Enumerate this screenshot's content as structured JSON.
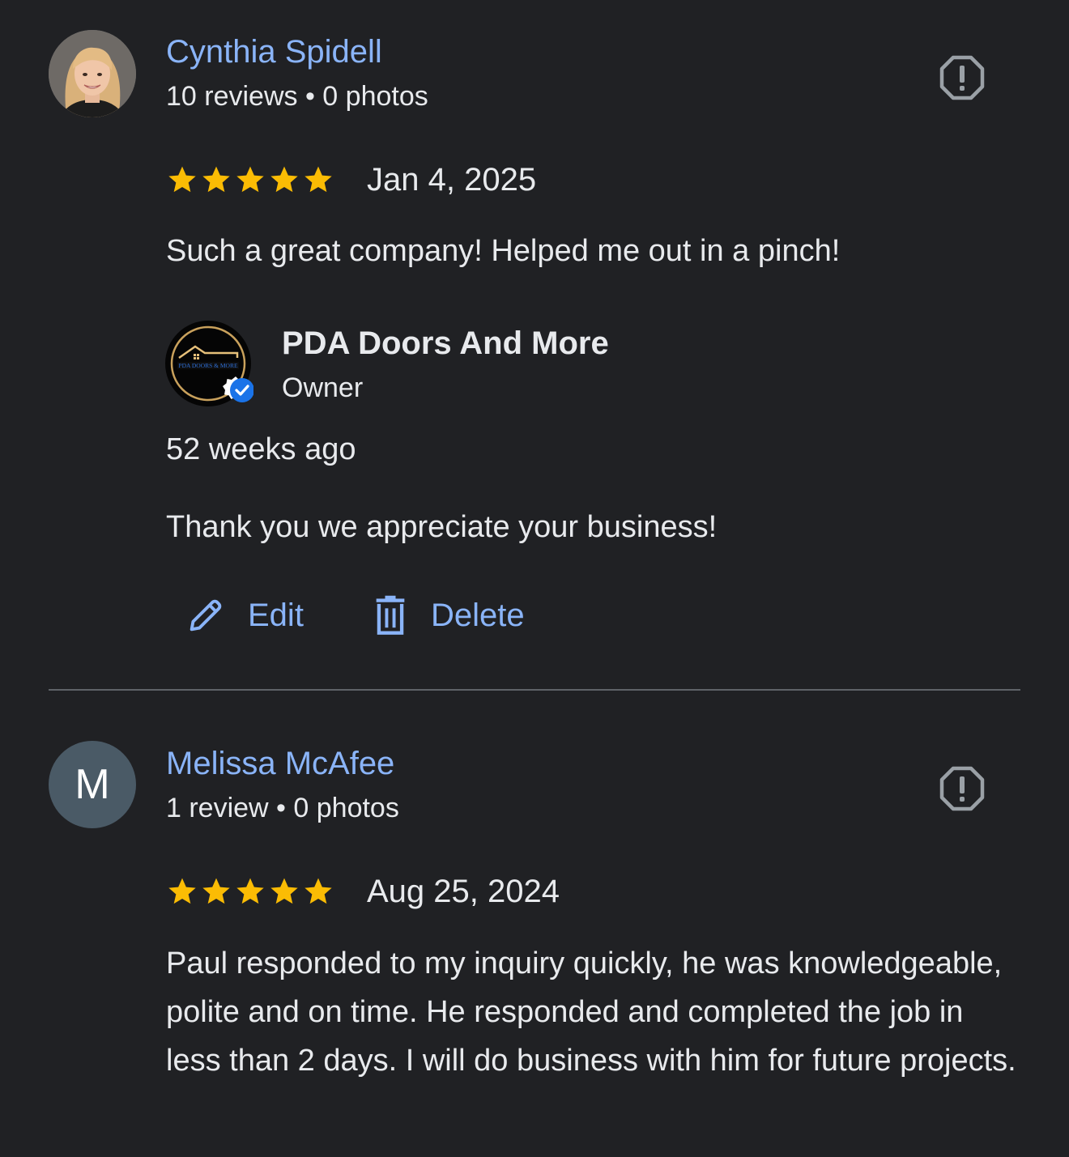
{
  "reviews": [
    {
      "reviewer_name": "Cynthia Spidell",
      "reviewer_meta": "10 reviews • 0 photos",
      "rating": 5,
      "date": "Jan 4, 2025",
      "text": "Such a great company! Helped me out in a pinch!",
      "owner_reply": {
        "name": "PDA Doors And More",
        "role": "Owner",
        "logo_text": "PDA DOORS & MORE",
        "time": "52 weeks ago",
        "text": "Thank you we appreciate your business!",
        "edit_label": "Edit",
        "delete_label": "Delete"
      }
    },
    {
      "reviewer_name": "Melissa McAfee",
      "avatar_letter": "M",
      "reviewer_meta": "1 review • 0 photos",
      "rating": 5,
      "date": "Aug 25, 2024",
      "text": "Paul responded to my inquiry quickly, he was knowledgeable, polite and on time. He responded and completed the job in less than 2 days. I will do business with him for future projects."
    }
  ],
  "colors": {
    "background": "#202124",
    "link": "#8ab4f8",
    "star": "#fbbc04",
    "text": "#e8eaed",
    "divider": "#5f6368",
    "verified": "#1a73e8"
  },
  "icons": {
    "report": "report-flag-icon",
    "edit": "pencil-icon",
    "delete": "trash-icon",
    "verified": "verified-badge-icon",
    "star": "star-icon"
  }
}
